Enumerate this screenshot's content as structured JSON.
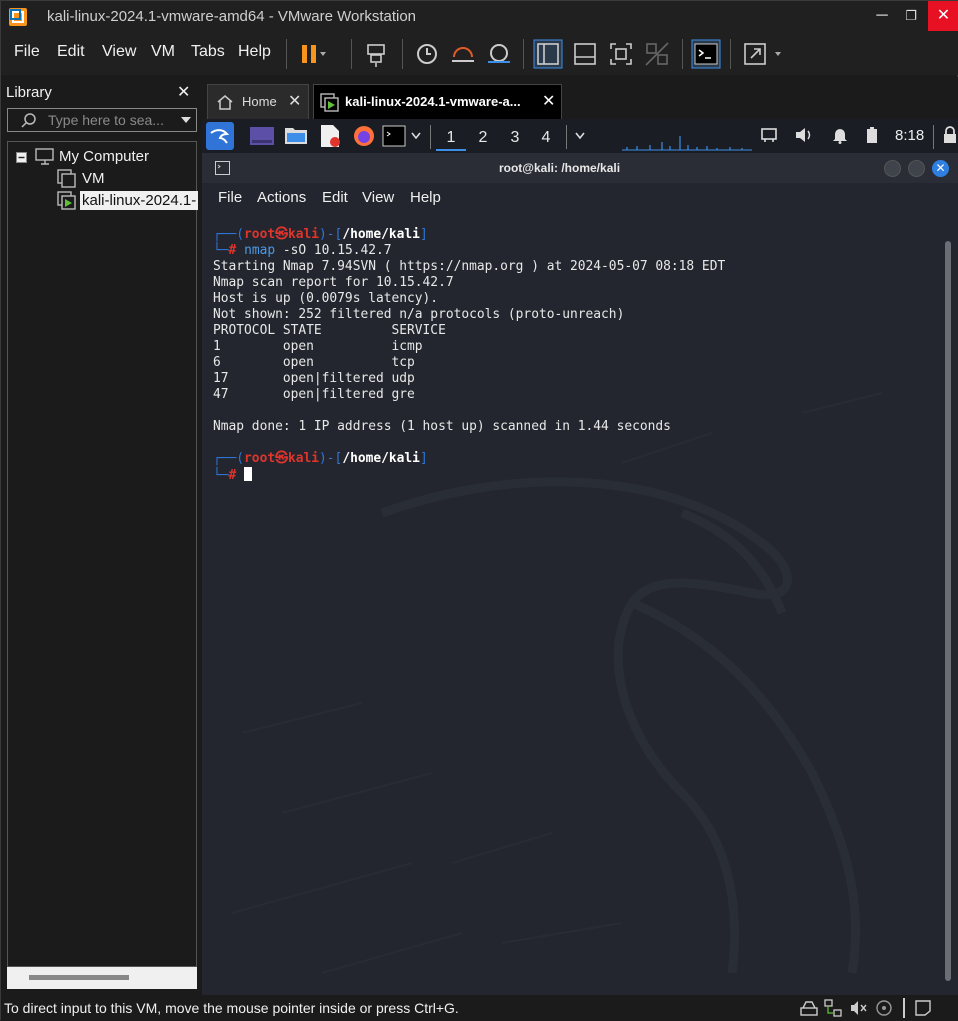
{
  "window": {
    "title": "kali-linux-2024.1-vmware-amd64 - VMware Workstation",
    "minimize": "─",
    "maximize": "❐",
    "close": "✕"
  },
  "menu": {
    "file": "File",
    "edit": "Edit",
    "view": "View",
    "vm": "VM",
    "tabs": "Tabs",
    "help": "Help"
  },
  "library": {
    "title": "Library",
    "close": "✕",
    "search_placeholder": "Type here to sea...",
    "tree": {
      "root": "My Computer",
      "items": [
        "VM",
        "kali-linux-2024.1-"
      ]
    }
  },
  "tabs": [
    {
      "label": "Home",
      "close": "✕"
    },
    {
      "label": "kali-linux-2024.1-vmware-a...",
      "close": "✕"
    }
  ],
  "kali_panel": {
    "workspaces": [
      "1",
      "2",
      "3",
      "4"
    ],
    "clock": "8:18"
  },
  "terminal": {
    "title": "root@kali: /home/kali",
    "menu": [
      "File",
      "Actions",
      "Edit",
      "View",
      "Help"
    ],
    "prompt": {
      "user": "root",
      "skull": "㉿",
      "host": "kali",
      "path": "/home/kali"
    },
    "command": "nmap",
    "command_args": " -sO 10.15.42.7",
    "output": [
      "Starting Nmap 7.94SVN ( https://nmap.org ) at 2024-05-07 08:18 EDT",
      "Nmap scan report for 10.15.42.7",
      "Host is up (0.0079s latency).",
      "Not shown: 252 filtered n/a protocols (proto-unreach)",
      "PROTOCOL STATE         SERVICE",
      "1        open          icmp",
      "6        open          tcp",
      "17       open|filtered udp",
      "47       open|filtered gre",
      "",
      "Nmap done: 1 IP address (1 host up) scanned in 1.44 seconds"
    ]
  },
  "status": {
    "text": "To direct input to this VM, move the mouse pointer inside or press Ctrl+G."
  },
  "colors": {
    "accent": "#2f74d6",
    "prompt_red": "#e0342c",
    "close_red": "#e81123"
  }
}
